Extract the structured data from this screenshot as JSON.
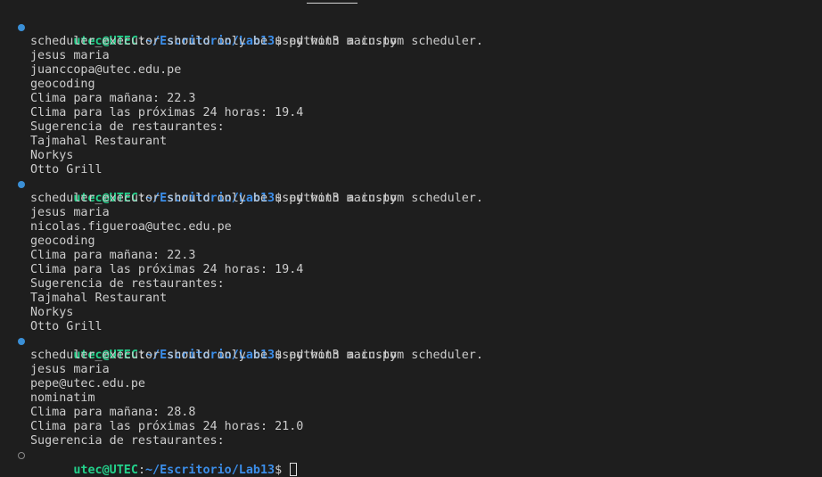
{
  "terminal": {
    "prompt": {
      "user_host": "utec@UTEC",
      "separator": ":",
      "path": "~/Escritorio/Lab13",
      "dollar": "$ "
    },
    "runs": [
      {
        "command": "python3 main.py",
        "output": [
          "scheduler_executor should only be used with a custom scheduler.",
          "jesus maria",
          "juanccopa@utec.edu.pe",
          "geocoding",
          "Clima para mañana: 22.3",
          "Clima para las próximas 24 horas: 19.4",
          "Sugerencia de restaurantes:",
          "Tajmahal Restaurant",
          "Norkys",
          "Otto Grill"
        ]
      },
      {
        "command": "python3 main.py",
        "output": [
          "scheduler_executor should only be used with a custom scheduler.",
          "jesus maria",
          "nicolas.figueroa@utec.edu.pe",
          "geocoding",
          "Clima para mañana: 22.3",
          "Clima para las próximas 24 horas: 19.4",
          "Sugerencia de restaurantes:",
          "Tajmahal Restaurant",
          "Norkys",
          "Otto Grill"
        ]
      },
      {
        "command": "python3 main.py",
        "output": [
          "scheduler_executor should only be used with a custom scheduler.",
          "jesus maria",
          "pepe@utec.edu.pe",
          "nominatim",
          "Clima para mañana: 28.8",
          "Clima para las próximas 24 horas: 21.0",
          "Sugerencia de restaurantes:"
        ]
      }
    ],
    "current_command": ""
  }
}
